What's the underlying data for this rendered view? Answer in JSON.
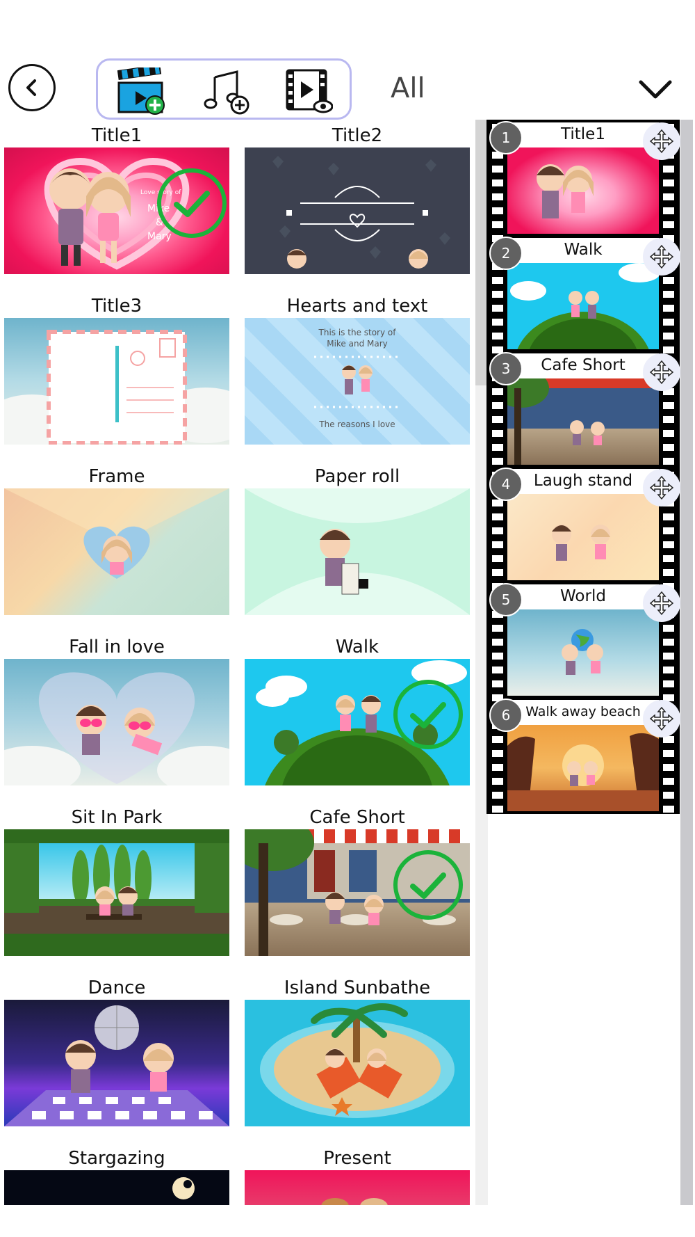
{
  "toolbar": {
    "back_icon": "chevron-left-icon",
    "tools": [
      {
        "name": "add-video-tool",
        "icon": "clapperboard-plus-icon"
      },
      {
        "name": "add-music-tool",
        "icon": "music-note-plus-icon"
      },
      {
        "name": "preview-tool",
        "icon": "film-eye-icon"
      }
    ],
    "filter_label": "All",
    "dropdown_icon": "chevron-down-icon"
  },
  "grid": [
    {
      "title": "Title1",
      "selected": true
    },
    {
      "title": "Title2",
      "selected": false
    },
    {
      "title": "Title3",
      "selected": false
    },
    {
      "title": "Hearts and text",
      "selected": false,
      "lines": [
        "This is the story of",
        "Mike and Mary",
        "The reasons I love"
      ]
    },
    {
      "title": "Frame",
      "selected": false
    },
    {
      "title": "Paper roll",
      "selected": false
    },
    {
      "title": "Fall in love",
      "selected": false
    },
    {
      "title": "Walk",
      "selected": true
    },
    {
      "title": "Sit In Park",
      "selected": false
    },
    {
      "title": "Cafe Short",
      "selected": true
    },
    {
      "title": "Dance",
      "selected": false
    },
    {
      "title": "Island Sunbathe",
      "selected": false
    },
    {
      "title": "Stargazing",
      "selected": false
    },
    {
      "title": "Present",
      "selected": false
    }
  ],
  "title1_thumb_text": [
    "Love story of",
    "Mike",
    "&",
    "Mary"
  ],
  "timeline": [
    {
      "number": "1",
      "title": "Title1"
    },
    {
      "number": "2",
      "title": "Walk"
    },
    {
      "number": "3",
      "title": "Cafe Short"
    },
    {
      "number": "4",
      "title": "Laugh stand"
    },
    {
      "number": "5",
      "title": "World"
    },
    {
      "number": "6",
      "title": "Walk away beach"
    }
  ],
  "colors": {
    "accent_border": "#b9b8f0",
    "check_green": "#1bb33a",
    "heart_pink": "#f0145a",
    "sky_blue": "#1ec8ee",
    "number_badge": "#616161"
  }
}
